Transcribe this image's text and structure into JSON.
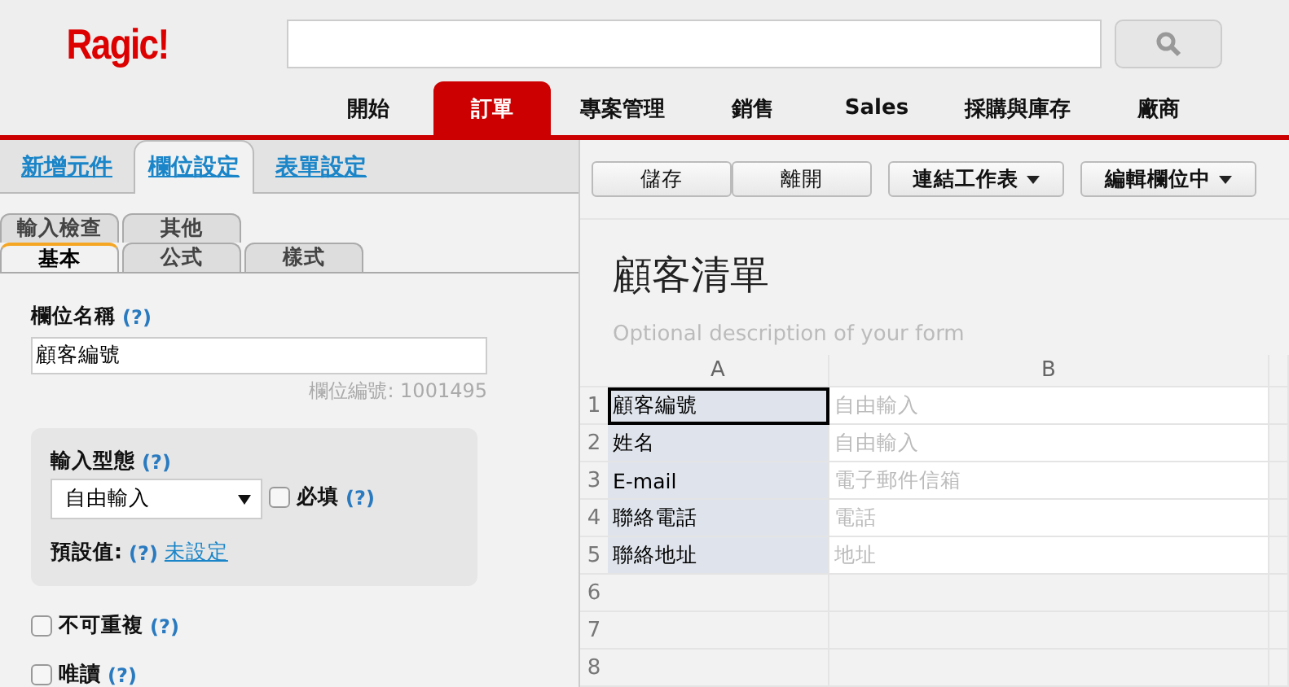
{
  "header": {
    "logo": "Ragic!",
    "nav": [
      {
        "label": "開始",
        "selected": false
      },
      {
        "label": "訂單",
        "selected": true
      },
      {
        "label": "專案管理",
        "selected": false
      },
      {
        "label": "銷售",
        "selected": false
      },
      {
        "label": "Sales",
        "selected": false
      },
      {
        "label": "採購與庫存",
        "selected": false
      },
      {
        "label": "廠商",
        "selected": false
      }
    ]
  },
  "left": {
    "tabs": [
      {
        "label": "新增元件",
        "selected": false
      },
      {
        "label": "欄位設定",
        "selected": true
      },
      {
        "label": "表單設定",
        "selected": false
      }
    ],
    "sub_tabs": [
      [
        {
          "label": "輸入檢查",
          "selected": false
        },
        {
          "label": "其他",
          "selected": false
        }
      ],
      [
        {
          "label": "基本",
          "selected": true
        },
        {
          "label": "公式",
          "selected": false
        },
        {
          "label": "樣式",
          "selected": false
        }
      ]
    ],
    "field_name": {
      "label": "欄位名稱",
      "help": "(?)",
      "value": "顧客編號",
      "id_text": "欄位編號: 1001495"
    },
    "input_type": {
      "label": "輸入型態",
      "help": "(?)",
      "value": "自由輸入",
      "required": {
        "label": "必填",
        "help": "(?)",
        "checked": false
      },
      "default_label": "預設值:",
      "default_help": "(?)",
      "default_link": "未設定"
    },
    "options": [
      {
        "label": "不可重複",
        "help": "(?)",
        "checked": false
      },
      {
        "label": "唯讀",
        "help": "(?)",
        "checked": false
      }
    ]
  },
  "right": {
    "buttons": [
      {
        "label": "儲存",
        "kind": "plain"
      },
      {
        "label": "離開",
        "kind": "plain"
      },
      {
        "label": "連結工作表",
        "kind": "dropdown"
      },
      {
        "label": "編輯欄位中",
        "kind": "dropdown"
      }
    ],
    "title": "顧客清單",
    "description_placeholder": "Optional description of your form",
    "columns": [
      "A",
      "B"
    ],
    "rows": [
      {
        "number": "1",
        "a": "顧客編號",
        "b": "自由輸入",
        "selected": true
      },
      {
        "number": "2",
        "a": "姓名",
        "b": "自由輸入",
        "selected": false
      },
      {
        "number": "3",
        "a": "E-mail",
        "b": "電子郵件信箱",
        "selected": false
      },
      {
        "number": "4",
        "a": "聯絡電話",
        "b": "電話",
        "selected": false
      },
      {
        "number": "5",
        "a": "聯絡地址",
        "b": "地址",
        "selected": false
      },
      {
        "number": "6"
      },
      {
        "number": "7"
      },
      {
        "number": "8"
      }
    ]
  }
}
